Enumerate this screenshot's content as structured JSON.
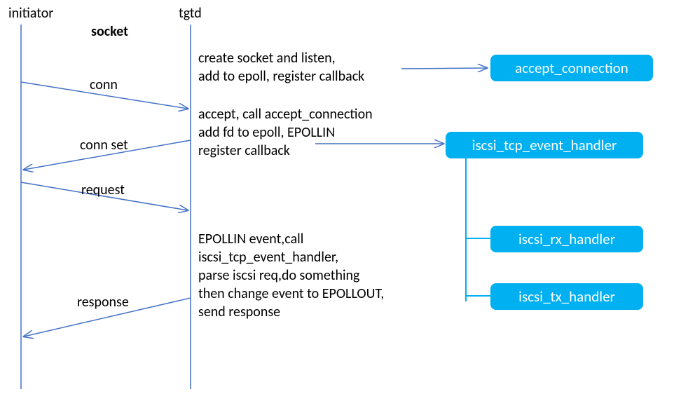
{
  "actors": {
    "initiator": "initiator",
    "tgtd": "tgtd",
    "socket": "socket"
  },
  "arrows": {
    "conn": "conn",
    "conn_set": "conn set",
    "request": "request",
    "response": "response"
  },
  "text": {
    "block1_l1": "create socket and listen,",
    "block1_l2": "add to epoll, register callback",
    "block2_l1": "accept, call accept_connection",
    "block2_l2": "add fd to epoll, EPOLLIN",
    "block2_l3": "register callback",
    "block3_l1": "EPOLLIN event,call",
    "block3_l2": "iscsi_tcp_event_handler,",
    "block3_l3": "parse iscsi req,do something",
    "block3_l4": "then change event to EPOLLOUT,",
    "block3_l5": "send response"
  },
  "boxes": {
    "accept_connection": "accept_connection",
    "iscsi_tcp_event_handler": "iscsi_tcp_event_handler",
    "iscsi_rx_handler": "iscsi_rx_handler",
    "iscsi_tx_handler": "iscsi_tx_handler"
  }
}
